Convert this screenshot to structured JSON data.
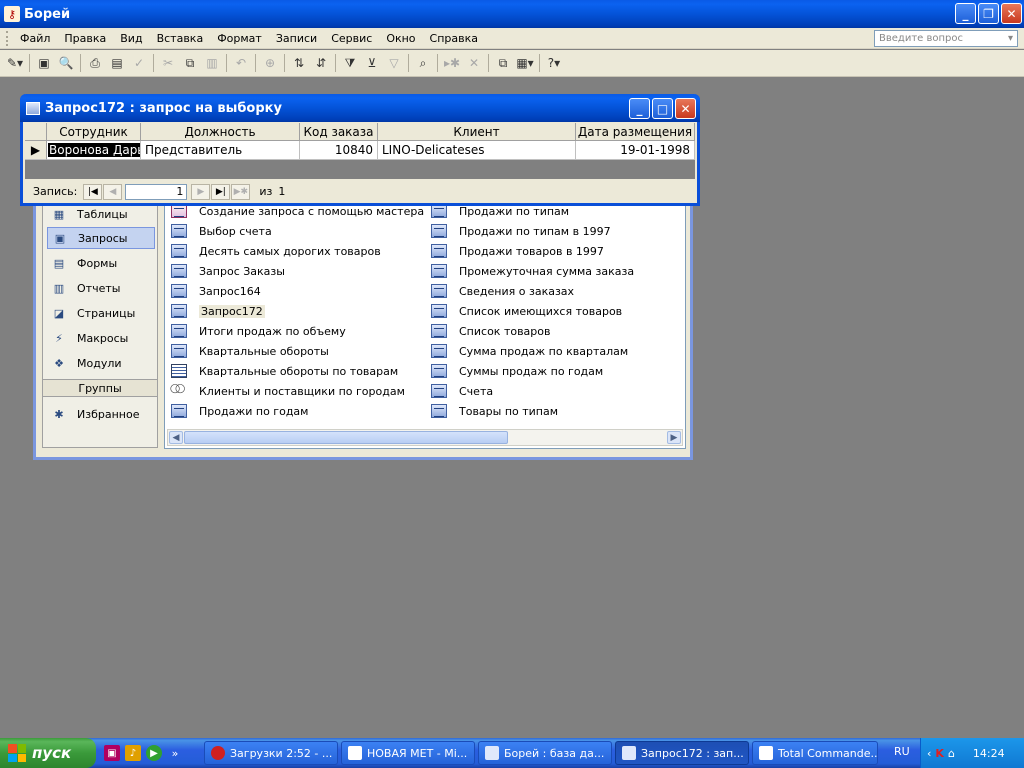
{
  "app": {
    "title": "Борей"
  },
  "menu": {
    "items": [
      "Файл",
      "Правка",
      "Вид",
      "Вставка",
      "Формат",
      "Записи",
      "Сервис",
      "Окно",
      "Справка"
    ],
    "ask_placeholder": "Введите вопрос"
  },
  "query_window": {
    "title": "Запрос172 : запрос на выборку",
    "columns": [
      "Сотрудник",
      "Должность",
      "Код заказа",
      "Клиент",
      "Дата размещения"
    ],
    "rows": [
      [
        "Воронова Дарья",
        "Представитель",
        "10840",
        "LINO-Delicateses",
        "19-01-1998"
      ]
    ],
    "nav": {
      "label": "Запись:",
      "current": "1",
      "of_label": "из",
      "total": "1"
    }
  },
  "db_window": {
    "objects": [
      "Таблицы",
      "Запросы",
      "Формы",
      "Отчеты",
      "Страницы",
      "Макросы",
      "Модули"
    ],
    "groups_header": "Группы",
    "favorites": "Избранное",
    "list_left": [
      "Создание запроса с помощью мастера",
      "Выбор счета",
      "Десять самых дорогих товаров",
      "Запрос Заказы",
      "Запрос164",
      "Запрос172",
      "Итоги продаж по объему",
      "Квартальные обороты",
      "Квартальные обороты по товарам",
      "Клиенты и поставщики по городам",
      "Продажи по годам"
    ],
    "list_right": [
      "Продажи по типам",
      "Продажи по типам в 1997",
      "Продажи товаров в 1997",
      "Промежуточная сумма заказа",
      "Сведения о заказах",
      "Список имеющихся товаров",
      "Список товаров",
      "Сумма продаж по кварталам",
      "Суммы продаж по годам",
      "Счета",
      "Товары по типам"
    ]
  },
  "taskbar": {
    "start": "пуск",
    "tasks": [
      "Загрузки 2:52 - ...",
      "НОВАЯ МЕТ - Mi...",
      "Борей : база да...",
      "Запрос172 : зап...",
      "Total Commande..."
    ],
    "lang": "RU",
    "clock": "14:24"
  }
}
